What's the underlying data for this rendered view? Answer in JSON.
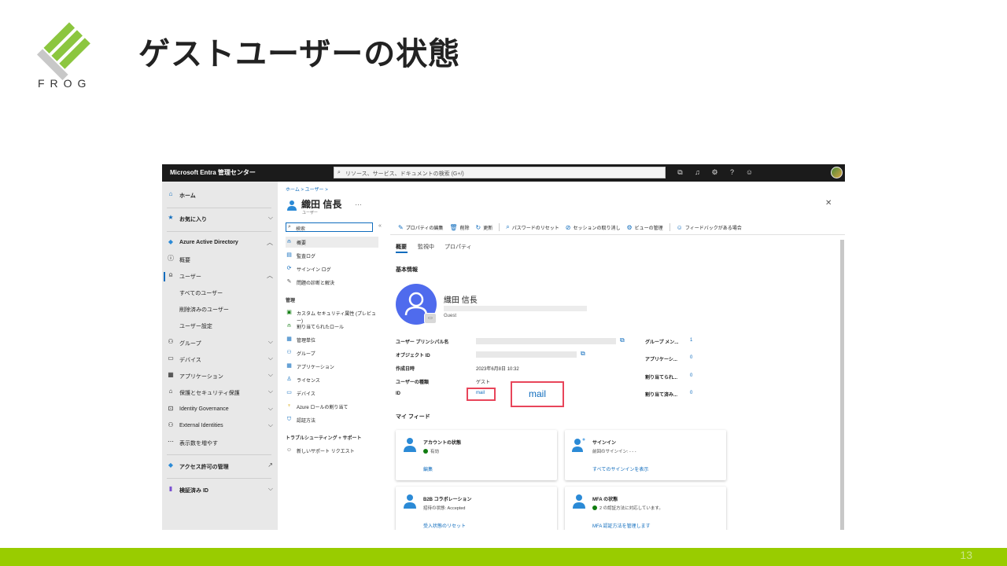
{
  "slide": {
    "title": "ゲストユーザーの状態",
    "logo_text": "FROG",
    "page_number": "13"
  },
  "topbar": {
    "title": "Microsoft Entra 管理センター",
    "search_placeholder": "リソース、サービス、ドキュメントの検索 (G+/)"
  },
  "leftnav": {
    "items": [
      {
        "label": "ホーム"
      },
      {
        "label": "お気に入り"
      },
      {
        "label": "Azure Active Directory"
      },
      {
        "label": "概要"
      },
      {
        "label": "ユーザー"
      },
      {
        "label": "すべてのユーザー"
      },
      {
        "label": "削除済みのユーザー"
      },
      {
        "label": "ユーザー設定"
      },
      {
        "label": "グループ"
      },
      {
        "label": "デバイス"
      },
      {
        "label": "アプリケーション"
      },
      {
        "label": "保護とセキュリティ保護"
      },
      {
        "label": "Identity Governance"
      },
      {
        "label": "External Identities"
      },
      {
        "label": "表示数を増やす"
      },
      {
        "label": "アクセス許可の管理"
      },
      {
        "label": "検証済み ID"
      }
    ]
  },
  "breadcrumb": "ホーム > ユーザー >",
  "user_header": {
    "name": "織田 信長",
    "more": "…",
    "subtitle": "ユーザー",
    "close": "✕"
  },
  "side_menu": {
    "search_placeholder": "検索",
    "collapse": "«",
    "items_top": [
      {
        "label": "概要"
      },
      {
        "label": "監査ログ"
      },
      {
        "label": "サインイン ログ"
      },
      {
        "label": "問題の診断と解決"
      }
    ],
    "manage_heading": "管理",
    "items_manage": [
      {
        "label": "カスタム セキュリティ属性 (プレビュー)"
      },
      {
        "label": "割り当てられたロール"
      },
      {
        "label": "管理単位"
      },
      {
        "label": "グループ"
      },
      {
        "label": "アプリケーション"
      },
      {
        "label": "ライセンス"
      },
      {
        "label": "デバイス"
      },
      {
        "label": "Azure ロールの割り当て"
      },
      {
        "label": "認証方法"
      }
    ],
    "trouble_heading": "トラブルシューティング + サポート",
    "items_trouble": [
      {
        "label": "新しいサポート リクエスト"
      }
    ]
  },
  "toolbar": {
    "edit": "プロパティの編集",
    "delete": "削除",
    "refresh": "更新",
    "reset_password": "パスワードのリセット",
    "revoke_sessions": "セッションの取り消し",
    "manage_view": "ビューの管理",
    "feedback": "フィードバックがある場合"
  },
  "tabs": [
    "概要",
    "監視中",
    "プロパティ"
  ],
  "basic_info_heading": "基本情報",
  "profile": {
    "name": "織田 信長",
    "type": "Guest",
    "badge": "▭"
  },
  "properties": {
    "upn_label": "ユーザー プリンシパル名",
    "object_id_label": "オブジェクト ID",
    "created_label": "作成日時",
    "created_value": "2023年6月8日 10:32",
    "user_type_label": "ユーザーの種類",
    "user_type_value": "ゲスト",
    "id_label": "ID",
    "id_value": "mail"
  },
  "stats": [
    {
      "label": "グループ メン...",
      "value": "1"
    },
    {
      "label": "アプリケーシ...",
      "value": "0"
    },
    {
      "label": "割り当てられ...",
      "value": "0"
    },
    {
      "label": "割り当て済み...",
      "value": "0"
    }
  ],
  "callout": "mail",
  "my_feed_heading": "マイ フィード",
  "cards": [
    {
      "title": "アカウントの状態",
      "status": "有効",
      "link": "編集"
    },
    {
      "title": "サインイン",
      "status": "前回のサインイン: - - -",
      "link": "すべてのサインインを表示"
    },
    {
      "title": "B2B コラボレーション",
      "status": "招待の状態: Accepted",
      "link": "受入状態のリセット"
    },
    {
      "title": "MFA の状態",
      "status": "2 の認証方法に対応しています。",
      "link": "MFA 認証方法を管理します"
    }
  ],
  "colors": {
    "accent_green": "#99cc00",
    "entra_blue": "#0f6cbd",
    "callout_red": "#e8455a",
    "avatar_blue": "#4f6bed"
  }
}
